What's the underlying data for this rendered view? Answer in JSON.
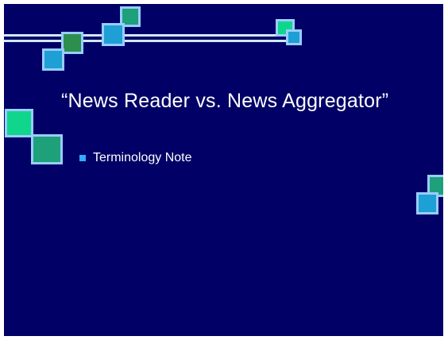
{
  "slide": {
    "title": "“News Reader vs. News Aggregator”",
    "bullets": [
      {
        "text": "Terminology Note"
      }
    ]
  },
  "theme": {
    "background": "#000066",
    "line_color": "#cfe8ff",
    "square_border": "#99ccff",
    "accent_colors": [
      "#1ea07a",
      "#2d8f4e",
      "#1e9fd5",
      "#0fd68c"
    ],
    "bullet_color": "#33aaff",
    "text_color": "#ffffff"
  }
}
